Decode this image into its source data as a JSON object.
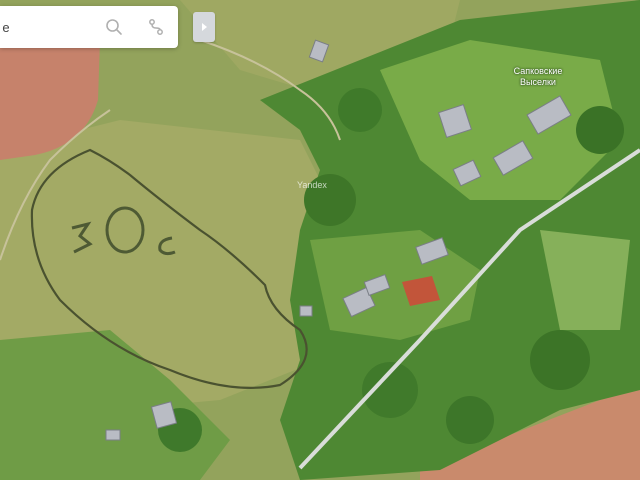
{
  "search": {
    "placeholder": "",
    "value": "ске"
  },
  "icons": {
    "search": "search-icon",
    "route": "route-icon",
    "collapse": "chevron-right-icon"
  },
  "map": {
    "place_label": "Сапковские Выселки",
    "watermark": "Yandex",
    "colors": {
      "meadow": "#9aa85f",
      "plowed_field": "#c9836a",
      "forest": "#4f8a32",
      "road": "#d8dcd8"
    }
  }
}
